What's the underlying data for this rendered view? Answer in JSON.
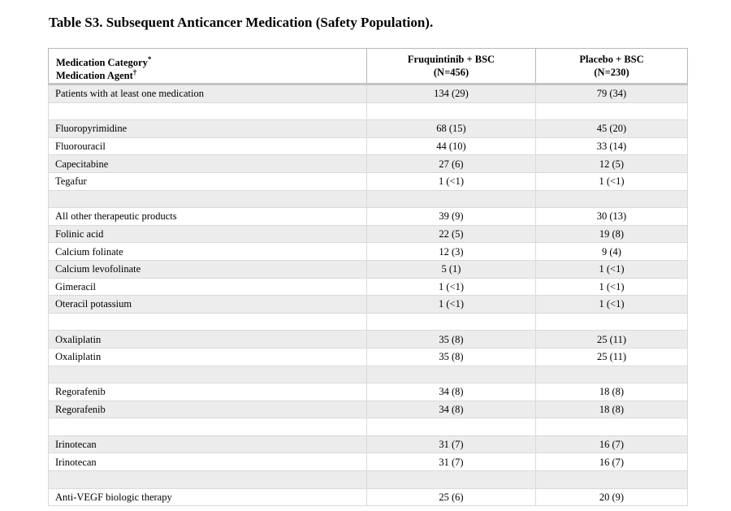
{
  "title": "Table S3. Subsequent Anticancer Medication (Safety Population).",
  "header": {
    "col1_line1": "Medication Category",
    "col1_line1_mark": "*",
    "col1_line2": "Medication Agent",
    "col1_line2_mark": "†",
    "col2_line1": "Fruquintinib + BSC",
    "col2_line2": "(N=456)",
    "col3_line1": "Placebo + BSC",
    "col3_line2": "(N=230)"
  },
  "rows": [
    {
      "label": "Patients with at least one medication",
      "fruq": "134 (29)",
      "placebo": "79 (34)"
    },
    {
      "label": "",
      "fruq": "",
      "placebo": ""
    },
    {
      "label": "Fluoropyrimidine",
      "fruq": "68 (15)",
      "placebo": "45 (20)"
    },
    {
      "label": "Fluorouracil",
      "fruq": "44 (10)",
      "placebo": "33 (14)"
    },
    {
      "label": "Capecitabine",
      "fruq": "27 (6)",
      "placebo": "12 (5)"
    },
    {
      "label": "Tegafur",
      "fruq": "1 (<1)",
      "placebo": "1 (<1)"
    },
    {
      "label": "",
      "fruq": "",
      "placebo": ""
    },
    {
      "label": "All other therapeutic products",
      "fruq": "39 (9)",
      "placebo": "30 (13)"
    },
    {
      "label": "Folinic acid",
      "fruq": "22 (5)",
      "placebo": "19 (8)"
    },
    {
      "label": "Calcium folinate",
      "fruq": "12 (3)",
      "placebo": "9 (4)"
    },
    {
      "label": "Calcium levofolinate",
      "fruq": "5 (1)",
      "placebo": "1 (<1)"
    },
    {
      "label": "Gimeracil",
      "fruq": "1 (<1)",
      "placebo": "1 (<1)"
    },
    {
      "label": "Oteracil potassium",
      "fruq": "1 (<1)",
      "placebo": "1 (<1)"
    },
    {
      "label": "",
      "fruq": "",
      "placebo": ""
    },
    {
      "label": "Oxaliplatin",
      "fruq": "35 (8)",
      "placebo": "25 (11)"
    },
    {
      "label": "Oxaliplatin",
      "fruq": "35 (8)",
      "placebo": "25 (11)"
    },
    {
      "label": "",
      "fruq": "",
      "placebo": ""
    },
    {
      "label": "Regorafenib",
      "fruq": "34 (8)",
      "placebo": "18 (8)"
    },
    {
      "label": "Regorafenib",
      "fruq": "34 (8)",
      "placebo": "18 (8)"
    },
    {
      "label": "",
      "fruq": "",
      "placebo": ""
    },
    {
      "label": "Irinotecan",
      "fruq": "31 (7)",
      "placebo": "16 (7)"
    },
    {
      "label": "Irinotecan",
      "fruq": "31 (7)",
      "placebo": "16 (7)"
    },
    {
      "label": "",
      "fruq": "",
      "placebo": ""
    },
    {
      "label": "Anti-VEGF biologic therapy",
      "fruq": "25 (6)",
      "placebo": "20 (9)"
    }
  ]
}
